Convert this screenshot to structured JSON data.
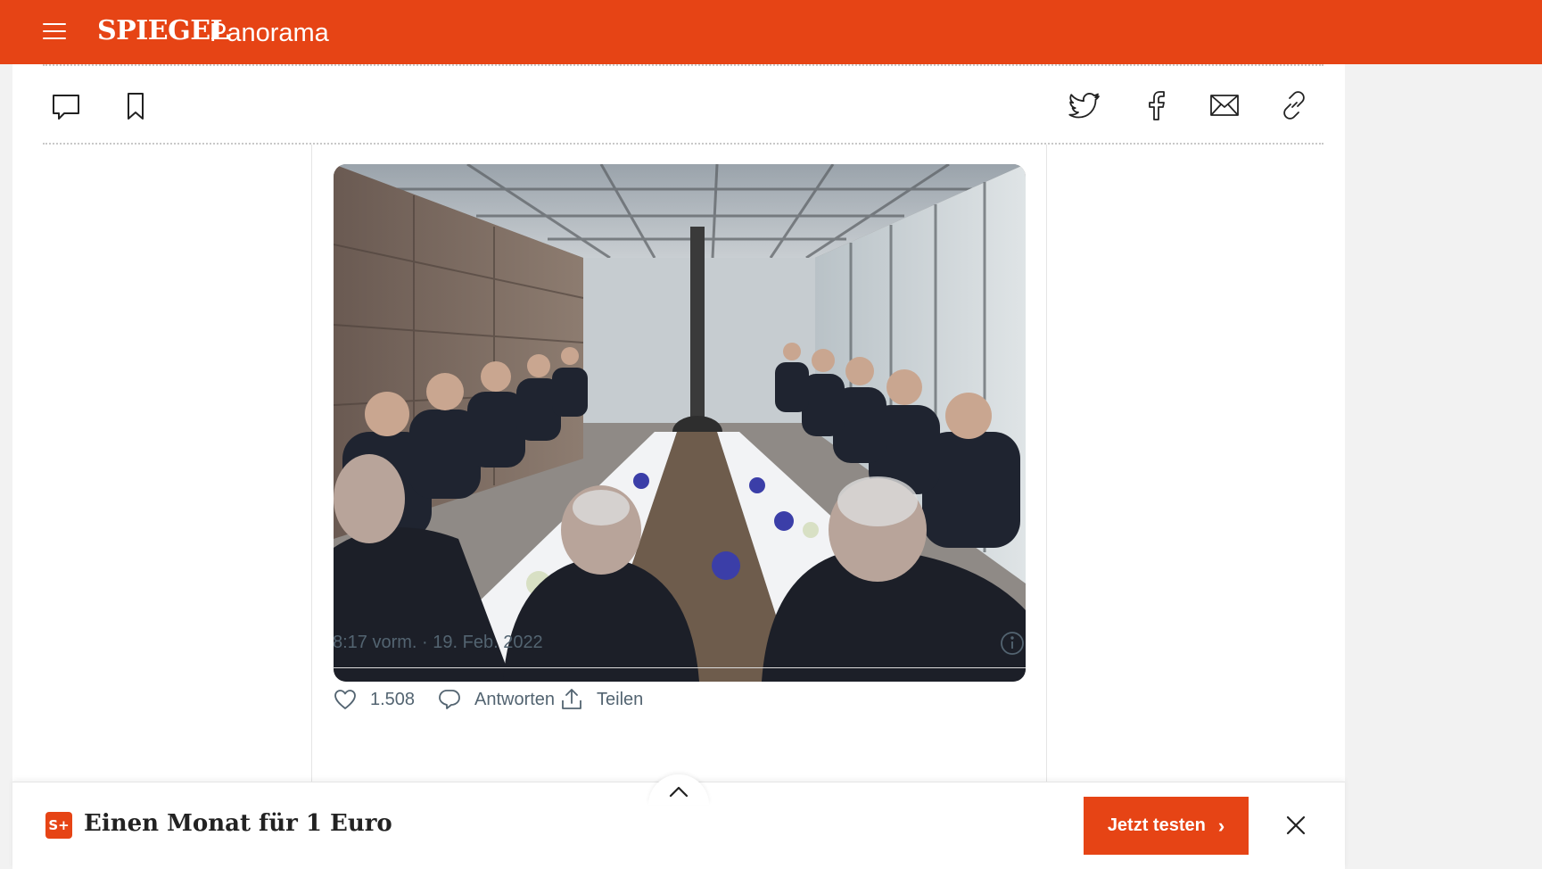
{
  "header": {
    "brand": "SPIEGEL",
    "section": "Panorama",
    "background_color": "#e64415"
  },
  "article_actions": {
    "left": [
      {
        "name": "comment-icon"
      },
      {
        "name": "bookmark-icon"
      }
    ],
    "share": [
      {
        "name": "twitter-icon"
      },
      {
        "name": "facebook-icon"
      },
      {
        "name": "mail-icon"
      },
      {
        "name": "link-icon"
      }
    ]
  },
  "tweet": {
    "timestamp": "8:17 vorm. · 19. Feb. 2022",
    "likes": "1.508",
    "reply_label": "Antworten",
    "share_label": "Teilen"
  },
  "promo": {
    "badge": "S+",
    "text": "Einen Monat für 1 Euro",
    "cta_label": "Jetzt testen",
    "cta_chevron": "›"
  }
}
